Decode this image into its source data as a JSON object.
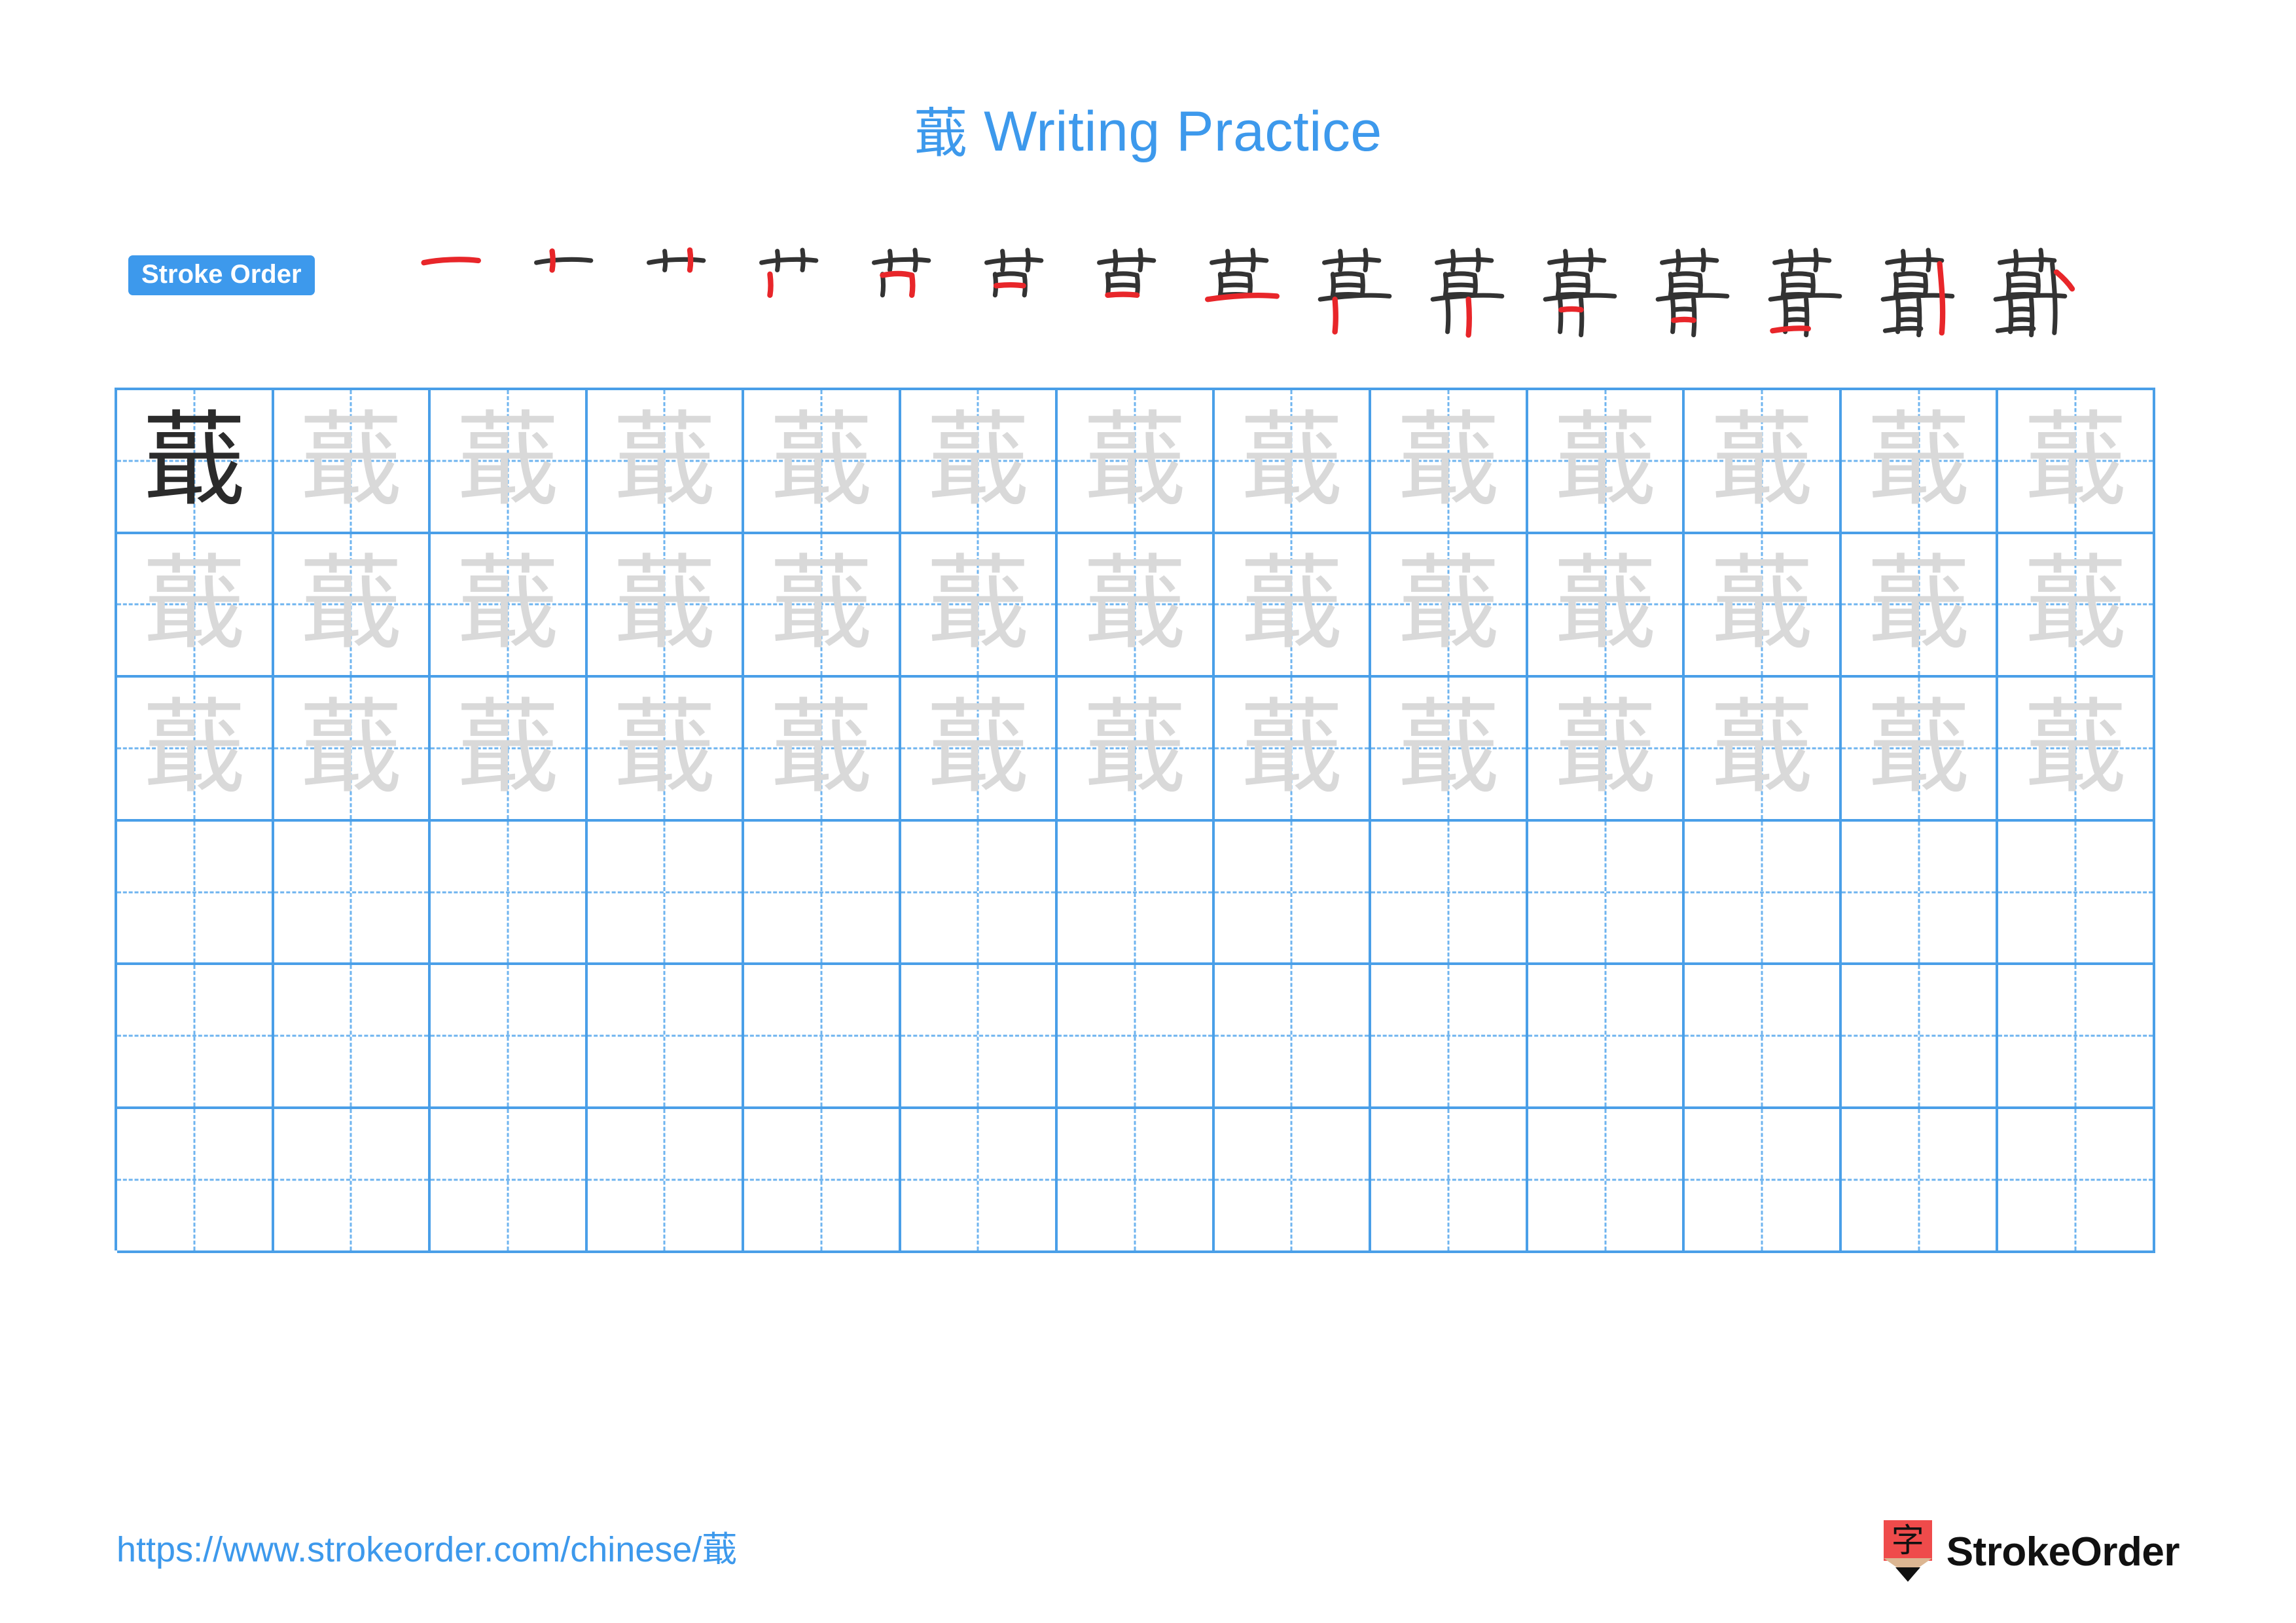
{
  "page": {
    "character": "蕺",
    "title_suffix": " Writing Practice",
    "background_color": "#ffffff"
  },
  "colors": {
    "accent_blue": "#3d99ec",
    "grid_blue": "#4a9fe8",
    "guide_blue": "#6fb4ef",
    "trace_gray": "#d9d9d9",
    "solid_char": "#2b2b2b",
    "stroke_new": "#e8262a",
    "stroke_old": "#333333",
    "logo_red": "#ef4b4b",
    "logo_wood": "#dcb692"
  },
  "stroke_order": {
    "badge_label": "Stroke Order",
    "total_strokes": 15,
    "steps": [
      1,
      2,
      3,
      4,
      5,
      6,
      7,
      8,
      9,
      10,
      11,
      12,
      13,
      14,
      15
    ]
  },
  "grid": {
    "columns": 13,
    "rows": 6,
    "filled_rows": 3,
    "empty_rows": 3,
    "first_cell_solid": true
  },
  "footer": {
    "url_prefix": "https://www.strokeorder.com/chinese/",
    "url_character": "蕺",
    "brand_name": "StrokeOrder",
    "brand_glyph": "字"
  }
}
